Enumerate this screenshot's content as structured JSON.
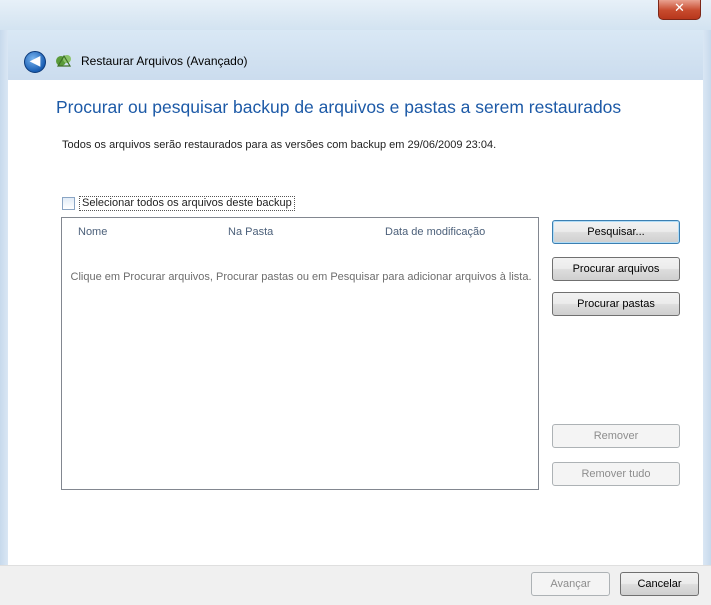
{
  "window": {
    "close_glyph": "✕"
  },
  "nav": {
    "back_glyph": "◀",
    "icon": "backup-restore-icon",
    "title": "Restaurar Arquivos (Avançado)"
  },
  "main": {
    "heading": "Procurar ou pesquisar backup de arquivos e pastas a serem restaurados",
    "description": "Todos os arquivos serão restaurados para as versões com backup em 29/06/2009 23:04.",
    "select_all_label": "Selecionar todos os arquivos deste backup",
    "list": {
      "columns": [
        "Nome",
        "Na Pasta",
        "Data de modificação"
      ],
      "empty_message": "Clique em Procurar arquivos, Procurar pastas ou em Pesquisar para adicionar arquivos à lista."
    }
  },
  "buttons": {
    "search": "Pesquisar...",
    "browse_files": "Procurar arquivos",
    "browse_folders": "Procurar pastas",
    "remove": "Remover",
    "remove_all": "Remover tudo"
  },
  "footer": {
    "next": "Avançar",
    "cancel": "Cancelar"
  },
  "colors": {
    "heading": "#1d5aa7",
    "titlebar": "#d3e3f1",
    "close": "#c74a2d"
  }
}
